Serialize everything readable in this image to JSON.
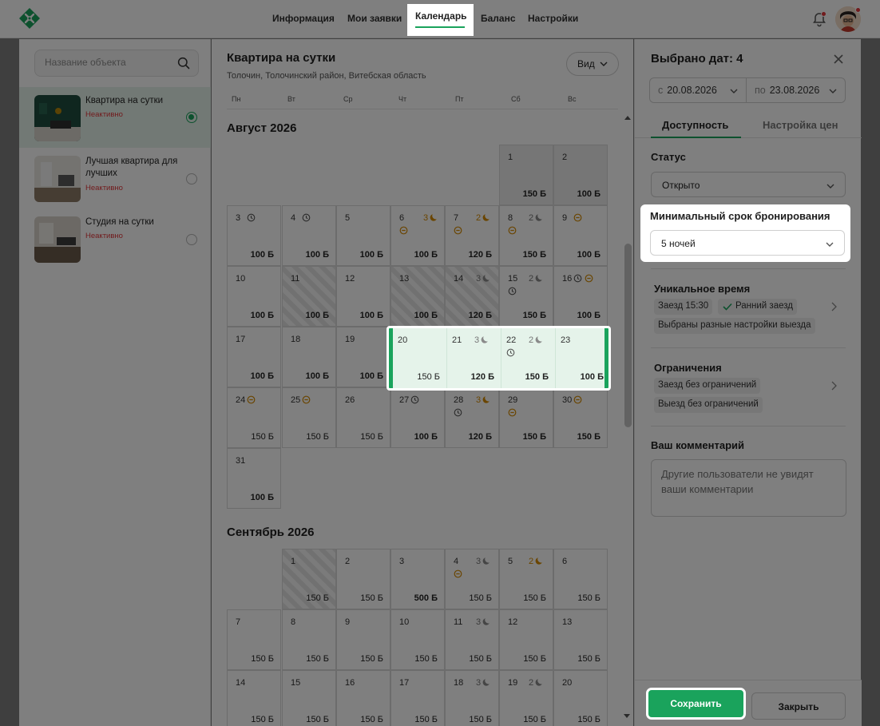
{
  "nav": {
    "items": [
      "Информация",
      "Мои заявки",
      "Календарь",
      "Баланс",
      "Настройки"
    ],
    "active": "Календарь"
  },
  "search": {
    "placeholder": "Название объекта"
  },
  "objects": [
    {
      "name": "Квартира на сутки",
      "status": "Неактивно",
      "selected": true
    },
    {
      "name": "Лучшая квартира для лучших",
      "status": "Неактивно",
      "selected": false
    },
    {
      "name": "Студия на сутки",
      "status": "Неактивно",
      "selected": false
    }
  ],
  "property": {
    "title": "Квартира на сутки",
    "address": "Толочин, Толочинский район, Витебская область",
    "view_label": "Вид"
  },
  "weekdays": [
    "Пн",
    "Вт",
    "Ср",
    "Чт",
    "Пт",
    "Сб",
    "Вс"
  ],
  "calendar": {
    "august": "Август 2026",
    "september": "Сентябрь 2026",
    "aug_days": [
      {
        "d": "1",
        "p": "150 Б"
      },
      {
        "d": "2",
        "p": "100 Б"
      },
      {
        "d": "3",
        "p": "100 Б"
      },
      {
        "d": "4",
        "p": "100 Б"
      },
      {
        "d": "5",
        "p": "100 Б"
      },
      {
        "d": "6",
        "n": "3",
        "p": "100 Б"
      },
      {
        "d": "7",
        "n": "2",
        "p": "120 Б"
      },
      {
        "d": "8",
        "n": "2",
        "p": "150 Б"
      },
      {
        "d": "9",
        "p": "100 Б"
      },
      {
        "d": "10",
        "p": "100 Б"
      },
      {
        "d": "11",
        "p": "100 Б"
      },
      {
        "d": "12",
        "p": "100 Б"
      },
      {
        "d": "13",
        "p": "100 Б"
      },
      {
        "d": "14",
        "n": "3",
        "p": "120 Б"
      },
      {
        "d": "15",
        "n": "2",
        "p": "150 Б"
      },
      {
        "d": "16",
        "p": "100 Б"
      },
      {
        "d": "17",
        "p": "100 Б"
      },
      {
        "d": "18",
        "p": "100 Б"
      },
      {
        "d": "19",
        "p": "100 Б"
      },
      {
        "d": "20",
        "p": "150 Б"
      },
      {
        "d": "21",
        "n": "3",
        "p": "120 Б"
      },
      {
        "d": "22",
        "n": "2",
        "p": "150 Б"
      },
      {
        "d": "23",
        "p": "100 Б"
      },
      {
        "d": "24",
        "p": "150 Б"
      },
      {
        "d": "25",
        "p": "150 Б"
      },
      {
        "d": "26",
        "p": "150 Б"
      },
      {
        "d": "27",
        "p": "100 Б"
      },
      {
        "d": "28",
        "n": "3",
        "p": "120 Б"
      },
      {
        "d": "29",
        "p": "150 Б"
      },
      {
        "d": "30",
        "p": "150 Б"
      },
      {
        "d": "31",
        "p": "100 Б"
      }
    ],
    "sep_days": [
      {
        "d": "1",
        "p": "150 Б"
      },
      {
        "d": "2",
        "p": "150 Б"
      },
      {
        "d": "3",
        "p": "500 Б"
      },
      {
        "d": "4",
        "n": "3",
        "p": "150 Б"
      },
      {
        "d": "5",
        "n": "2",
        "p": "150 Б"
      },
      {
        "d": "6",
        "p": "150 Б"
      },
      {
        "d": "7",
        "p": "150 Б"
      },
      {
        "d": "8",
        "p": "150 Б"
      },
      {
        "d": "9",
        "p": "150 Б"
      },
      {
        "d": "10",
        "p": "150 Б"
      },
      {
        "d": "11",
        "n": "3",
        "p": "150 Б"
      },
      {
        "d": "12",
        "p": "150 Б"
      },
      {
        "d": "13",
        "p": "150 Б"
      },
      {
        "d": "14",
        "p": "150 Б"
      },
      {
        "d": "15",
        "p": "150 Б"
      },
      {
        "d": "16",
        "p": "150 Б"
      },
      {
        "d": "17",
        "p": "150 Б"
      },
      {
        "d": "18",
        "n": "3",
        "p": "150 Б"
      },
      {
        "d": "19",
        "n": "2",
        "p": "150 Б"
      },
      {
        "d": "20",
        "p": "150 Б"
      }
    ]
  },
  "panel": {
    "title": "Выбрано дат: 4",
    "from_label": "с",
    "from": "20.08.2026",
    "to_label": "по",
    "to": "23.08.2026",
    "tab_availability": "Доступность",
    "tab_prices": "Настройка цен",
    "status_label": "Статус",
    "status_value": "Открыто",
    "min_label": "Минимальный срок бронирования",
    "min_value": "5 ночей",
    "unique_label": "Уникальное время",
    "checkin_time": "Заезд 15:30",
    "early_checkin": "Ранний заезд",
    "checkout_note": "Выбраны разные настройки выезда",
    "limits_label": "Ограничения",
    "checkin_limit": "Заезд без ограничений",
    "checkout_limit": "Выезд без ограничений",
    "comment_label": "Ваш комментарий",
    "comment_placeholder": "Другие пользователи не увидят ваши комментарии",
    "save": "Сохранить",
    "close": "Закрыть"
  }
}
